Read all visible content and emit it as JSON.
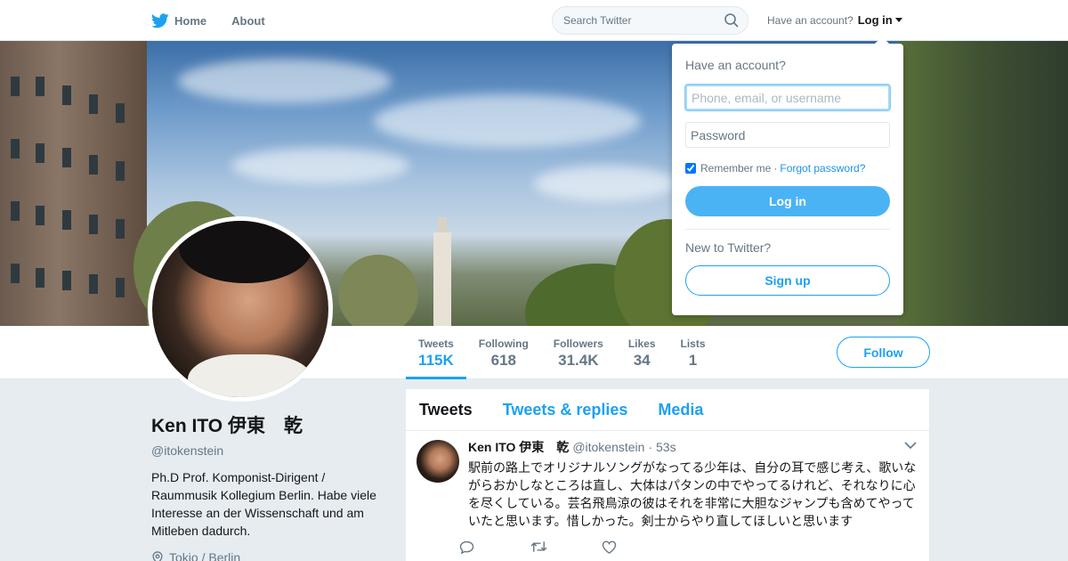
{
  "nav": {
    "home_label": "Home",
    "about_label": "About",
    "search_placeholder": "Search Twitter",
    "have_account": "Have an account?",
    "login_label": "Log in"
  },
  "profile": {
    "name": "Ken ITO 伊東　乾",
    "handle": "@itokenstein",
    "bio": "Ph.D Prof. Komponist-Dirigent / Raummusik Kollegium Berlin. Habe viele Interesse an der Wissenschaft und am Mitleben dadurch.",
    "location": "Tokio / Berlin"
  },
  "stats": [
    {
      "label": "Tweets",
      "value": "115K",
      "active": true
    },
    {
      "label": "Following",
      "value": "618"
    },
    {
      "label": "Followers",
      "value": "31.4K"
    },
    {
      "label": "Likes",
      "value": "34"
    },
    {
      "label": "Lists",
      "value": "1"
    }
  ],
  "follow_label": "Follow",
  "tabs": [
    "Tweets",
    "Tweets & replies",
    "Media"
  ],
  "tweet": {
    "name": "Ken ITO 伊東　乾",
    "handle": "@itokenstein",
    "time": "· 53s",
    "text": "駅前の路上でオリジナルソングがなってる少年は、自分の耳で感じ考え、歌いながらおかしなところは直し、大体はパタンの中でやってるけれど、それなりに心を尽くしている。芸名飛鳥涼の彼はそれを非常に大胆なジャンプも含めてやっていたと思います。惜しかった。剣士からやり直してほしいと思います"
  },
  "login_dropdown": {
    "title": "Have an account?",
    "username_placeholder": "Phone, email, or username",
    "password_placeholder": "Password",
    "remember_label": "Remember me",
    "separator": "·",
    "forgot_label": "Forgot password?",
    "login_button": "Log in",
    "new_label": "New to Twitter?",
    "signup_button": "Sign up"
  },
  "colors": {
    "accent": "#1da1f2",
    "page_bg": "#e6ecf0"
  }
}
